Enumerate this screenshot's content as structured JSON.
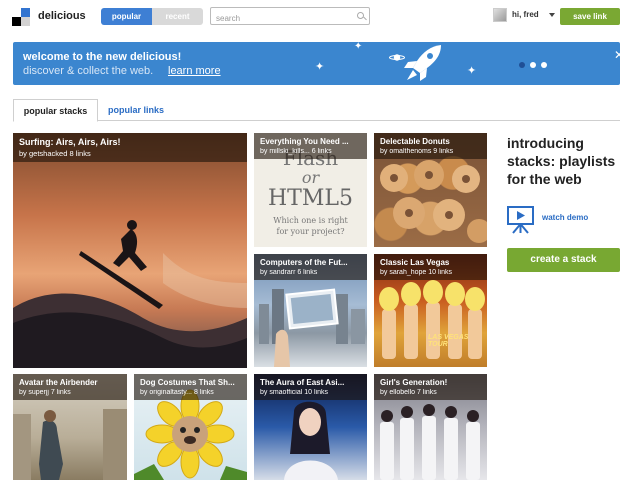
{
  "header": {
    "brand": "delicious",
    "toggle": {
      "popular": "popular",
      "recent": "recent"
    },
    "search": {
      "placeholder": "search",
      "value": ""
    },
    "user_label": "hi, fred",
    "save_link": "save link"
  },
  "banner": {
    "title": "welcome to the new delicious!",
    "subtitle": "discover & collect the web.",
    "link": "learn more",
    "close": "✕"
  },
  "tabs": [
    {
      "label": "popular stacks",
      "active": true
    },
    {
      "label": "popular links",
      "active": false
    }
  ],
  "stacks": [
    {
      "title": "Surfing: Airs, Airs, Airs!",
      "by": "by getshacked 8 links"
    },
    {
      "title": "Everything You Need ...",
      "by": "by millski_kills... 6 links",
      "art_lines": [
        "Flash",
        "or",
        "HTML5",
        "Which one is right",
        "for your project?"
      ]
    },
    {
      "title": "Delectable Donuts",
      "by": "by omalthenoms 9 links"
    },
    {
      "title": "Computers of the Fut...",
      "by": "by sandrarr 6 links"
    },
    {
      "title": "Classic Las Vegas",
      "by": "by sarah_hope 10 links",
      "art_text": "LAS VEGAS TOUR"
    },
    {
      "title": "Avatar the Airbender",
      "by": "by superjj 7 links"
    },
    {
      "title": "Dog Costumes That Sh...",
      "by": "by originaltasty... 8 links"
    },
    {
      "title": "The Aura of East Asi...",
      "by": "by smaofficial 10 links"
    },
    {
      "title": "Girl's Generation!",
      "by": "by ellobello 7 links"
    }
  ],
  "promo": {
    "title": "introducing stacks: playlists for the web",
    "demo": "watch demo",
    "create": "create a stack"
  },
  "colors": {
    "brand_blue": "#3b86cf",
    "link_blue": "#2a6cc4",
    "green": "#78a832"
  }
}
